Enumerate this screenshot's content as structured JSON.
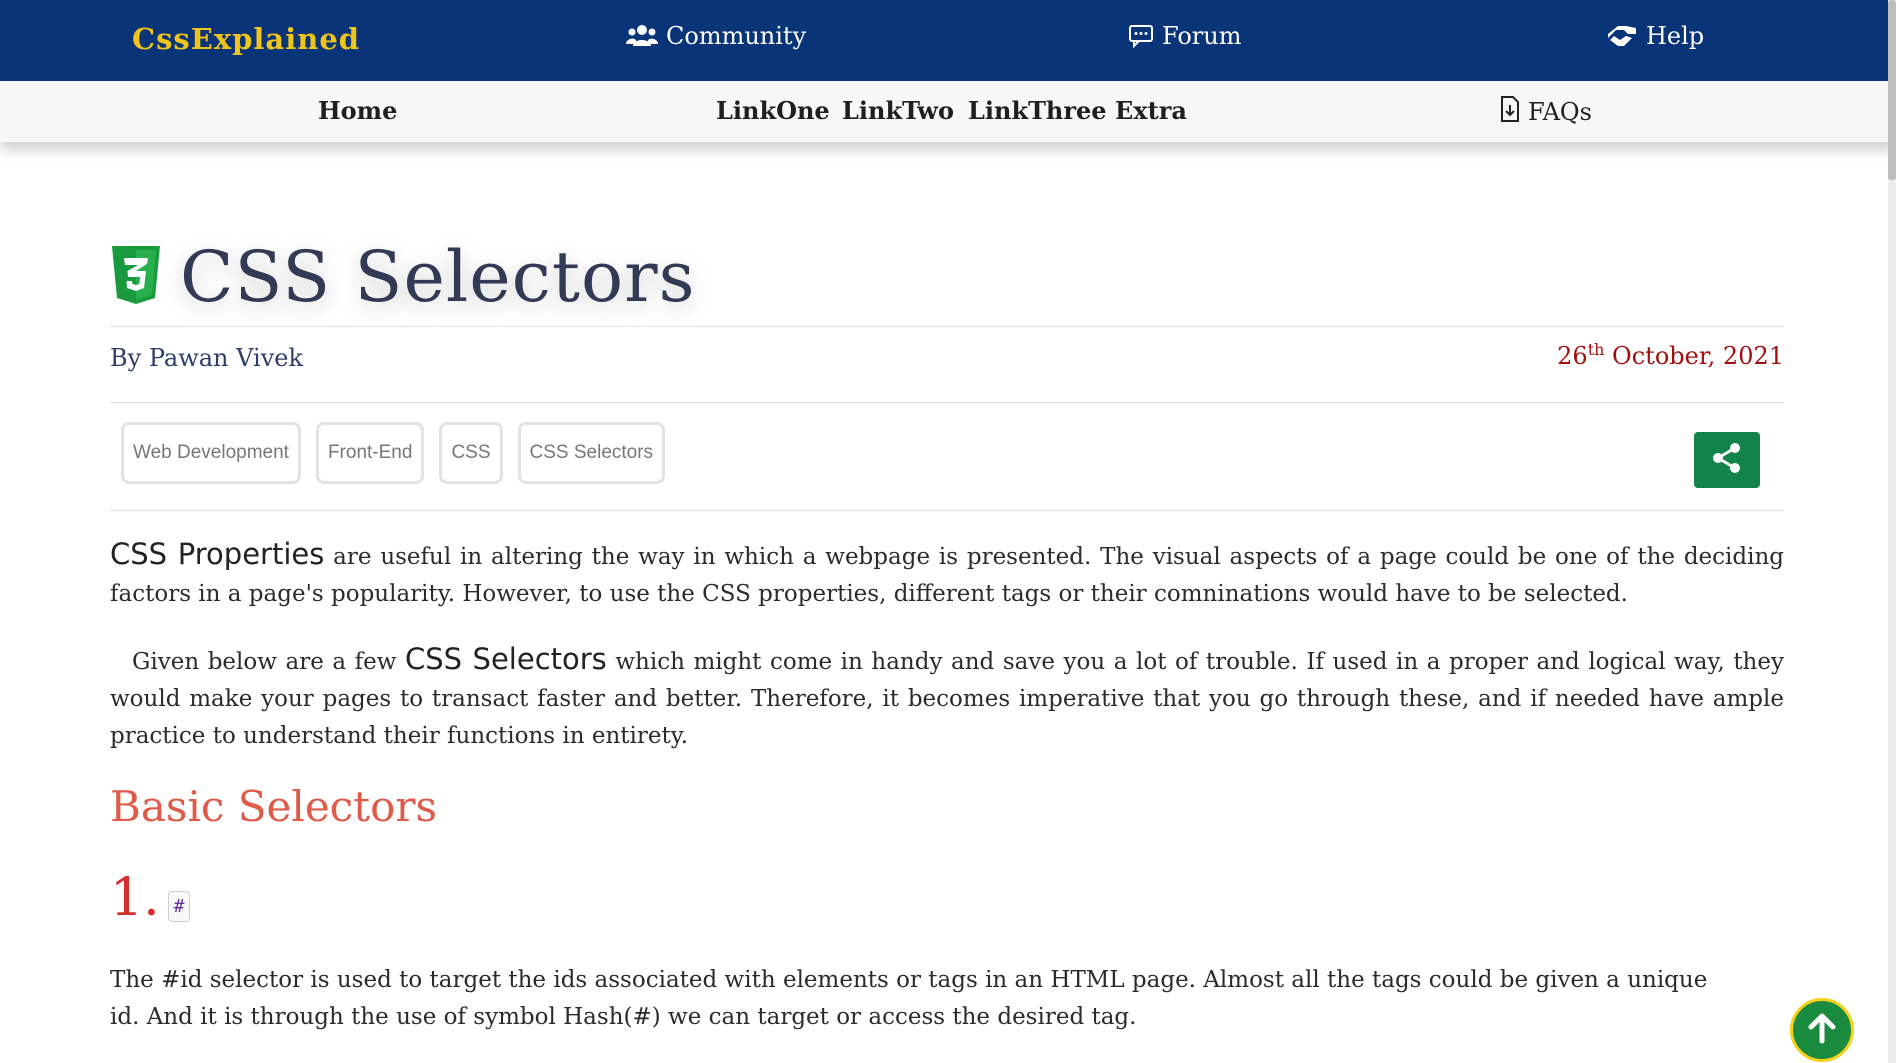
{
  "header": {
    "brand": "CssExplained",
    "nav": [
      {
        "label": "Community",
        "icon": "users-icon"
      },
      {
        "label": "Forum",
        "icon": "chat-icon"
      },
      {
        "label": "Help",
        "icon": "handshake-icon"
      }
    ]
  },
  "subnav": {
    "home": "Home",
    "links": [
      "LinkOne",
      "LinkTwo",
      "LinkThree",
      "Extra"
    ],
    "faqs": "FAQs"
  },
  "article": {
    "title": "CSS Selectors",
    "author": "By Pawan Vivek",
    "date_day": "26",
    "date_sup": "th",
    "date_rest": " October, 2021",
    "tags": [
      "Web Development",
      "Front-End",
      "CSS",
      "CSS Selectors"
    ],
    "p1_lead": "CSS Properties",
    "p1_rest": " are useful in altering the way in which a webpage is presented. The visual aspects of a page could be one of the deciding factors in a page's popularity. However, to use the CSS properties, different tags or their comninations would have to be selected.",
    "p2_start": "Given below are a few ",
    "p2_lead": "CSS Selectors",
    "p2_rest": " which might come in handy and save you a lot of trouble. If used in a proper and logical way, they would make your pages to transact faster and better. Therefore, it becomes imperative that you go through these, and if needed have ample practice to understand their functions in entirety.",
    "section_heading": "Basic Selectors",
    "item_number": "1.",
    "item_code": "#",
    "item_text": "The #id selector is used to target the ids associated with elements or tags in an HTML page. Almost all the tags could be given a unique id. And it is through the use of symbol Hash(#) we can target or access the desired tag."
  },
  "colors": {
    "topbar": "#0a3478",
    "brand": "#f0c419",
    "heading_red": "#e05a4a",
    "date_red": "#a30f0f",
    "share_green": "#12844b"
  },
  "icons": {
    "title_logo": "css3-icon",
    "share": "share-icon",
    "back_to_top": "arrow-up-icon",
    "faqs": "file-download-icon"
  }
}
